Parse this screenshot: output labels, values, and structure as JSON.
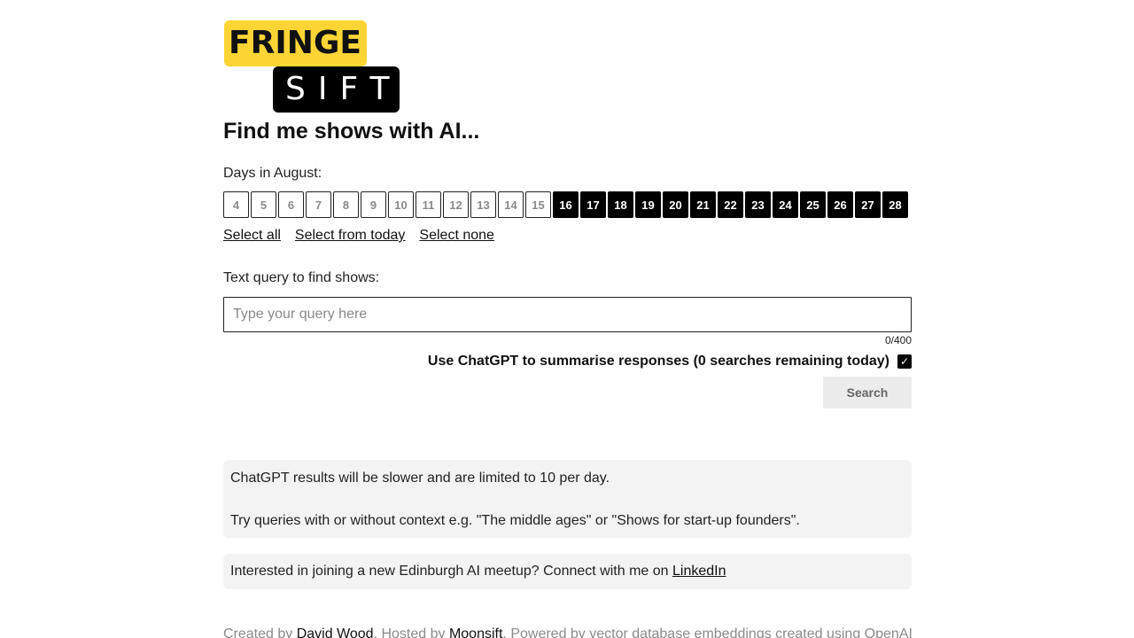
{
  "logo": {
    "top_word": "FRINGE",
    "bottom_word": "SIFT",
    "colors": {
      "yellow": "#fcd535",
      "black": "#000000"
    }
  },
  "title": "Find me shows with AI...",
  "days_label": "Days in August:",
  "days": [
    {
      "label": "4",
      "selected": false
    },
    {
      "label": "5",
      "selected": false
    },
    {
      "label": "6",
      "selected": false
    },
    {
      "label": "7",
      "selected": false
    },
    {
      "label": "8",
      "selected": false
    },
    {
      "label": "9",
      "selected": false
    },
    {
      "label": "10",
      "selected": false
    },
    {
      "label": "11",
      "selected": false
    },
    {
      "label": "12",
      "selected": false
    },
    {
      "label": "13",
      "selected": false
    },
    {
      "label": "14",
      "selected": false
    },
    {
      "label": "15",
      "selected": false
    },
    {
      "label": "16",
      "selected": true
    },
    {
      "label": "17",
      "selected": true
    },
    {
      "label": "18",
      "selected": true
    },
    {
      "label": "19",
      "selected": true
    },
    {
      "label": "20",
      "selected": true
    },
    {
      "label": "21",
      "selected": true
    },
    {
      "label": "22",
      "selected": true
    },
    {
      "label": "23",
      "selected": true
    },
    {
      "label": "24",
      "selected": true
    },
    {
      "label": "25",
      "selected": true
    },
    {
      "label": "26",
      "selected": true
    },
    {
      "label": "27",
      "selected": true
    },
    {
      "label": "28",
      "selected": true
    }
  ],
  "select_links": {
    "all": "Select all",
    "from_today": "Select from today",
    "none": "Select none"
  },
  "query": {
    "label": "Text query to find shows:",
    "value": "",
    "placeholder": "Type your query here",
    "counter": "0/400"
  },
  "chatgpt": {
    "label": "Use ChatGPT to summarise responses (0 searches remaining today)",
    "checked": true
  },
  "search_button": "Search",
  "info": {
    "line1": "ChatGPT results will be slower and are limited to 10 per day.",
    "line2": "Try queries with or without context e.g. \"The middle ages\" or \"Shows for start-up founders\"."
  },
  "meetup": {
    "text": "Interested in joining a new Edinburgh AI meetup? Connect with me on ",
    "link": "LinkedIn"
  },
  "footer": {
    "created_by": "Created by ",
    "author": "David Wood",
    "hosted_by": ". Hosted by ",
    "host": "Moonsift",
    "powered": ". Powered by vector database embeddings created using OpenAI"
  }
}
